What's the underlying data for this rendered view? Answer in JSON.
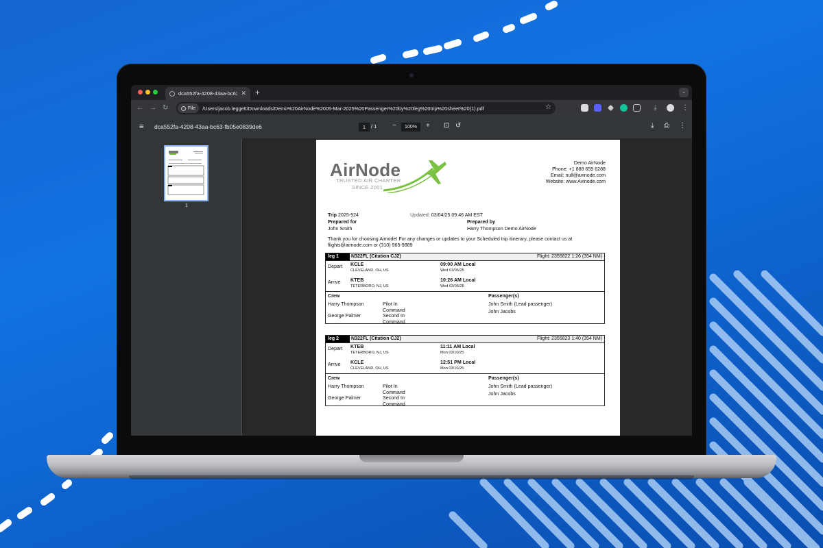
{
  "browser": {
    "tab_title": "dca552fa-4208-43aa-bc63-",
    "file_chip": "File",
    "url": "/Users/jacob.leggett/Downloads/Demo%20AirNode%2005-Mar-2025%20Passenger%20by%20leg%20trip%20sheet%20(1).pdf",
    "icons": [
      "back-icon",
      "forward-icon",
      "reload-icon",
      "star-icon",
      "download-icon",
      "menu-icon"
    ]
  },
  "pdf_viewer": {
    "title": "dca552fa-4208-43aa-bc63-fb05e0839de6",
    "page_current": "1",
    "page_total": "/ 1",
    "zoom": "100%",
    "thumbnail_label": "1"
  },
  "document": {
    "logo": {
      "name": "AirNode",
      "tagline_1": "TRUSTED AIR CHARTER",
      "tagline_2": "SINCE 2001",
      "color_green": "#7ac143",
      "color_gray": "#6a6a6a"
    },
    "company": {
      "name": "Demo AirNode",
      "phone_label": "Phone:",
      "phone": "+1 888 659 6288",
      "email_label": "Email:",
      "email": "null@avinode.com",
      "website_label": "Website:",
      "website": "www.Avinode.com"
    },
    "trip": {
      "label": "Trip",
      "number": "2025-924",
      "updated_label": "Updated:",
      "updated": "03/04/25 09:46 AM EST",
      "prepared_for_label": "Prepared for",
      "prepared_for": "John Smith",
      "prepared_by_label": "Prepared by",
      "prepared_by": "Harry Thompson Demo AirNode"
    },
    "greeting_line_1": "Thank you for choosing Aimode! For any changes or updates to your Scheduled trip itinerary, please contact us at",
    "greeting_line_2": "flights@airnode.com or (310) 965-9889",
    "legs": [
      {
        "label": "leg 1",
        "aircraft": "N322FL (Citation CJ2)",
        "flight": "Flight: 2355822 1:26 (354 NM)",
        "depart_label": "Depart",
        "depart_code": "KCLE",
        "depart_city": "CLEVELAND, OH, US",
        "depart_time": "09:00 AM Local",
        "depart_date": "Wed 03/05/25",
        "arrive_label": "Arrive",
        "arrive_code": "KTEB",
        "arrive_city": "TETERBORO, NJ, US",
        "arrive_time": "10:26 AM Local",
        "arrive_date": "Wed 03/05/25",
        "crew_label": "Crew",
        "crew": [
          {
            "name": "Harry Thompson",
            "role_1": "Pilot In",
            "role_2": "Command"
          },
          {
            "name": "George Palmer",
            "role_1": "Second In",
            "role_2": "Command"
          }
        ],
        "passengers_label": "Passenger(s)",
        "passengers": [
          "John Smith (Lead passenger)",
          "John Jacobs"
        ]
      },
      {
        "label": "leg 2",
        "aircraft": "N322FL (Citation CJ2)",
        "flight": "Flight: 2355823 1:40 (354 NM)",
        "depart_label": "Depart",
        "depart_code": "KTEB",
        "depart_city": "TETERBORO, NJ, US",
        "depart_time": "11:11 AM Local",
        "depart_date": "Mon 03/10/25",
        "arrive_label": "Arrive",
        "arrive_code": "KCLE",
        "arrive_city": "CLEVELAND, OH, US",
        "arrive_time": "12:51 PM Local",
        "arrive_date": "Mon 03/10/25",
        "crew_label": "Crew",
        "crew": [
          {
            "name": "Harry Thompson",
            "role_1": "Pilot In",
            "role_2": "Command"
          },
          {
            "name": "George Palmer",
            "role_1": "Second In",
            "role_2": "Command"
          }
        ],
        "passengers_label": "Passenger(s)",
        "passengers": [
          "John Smith (Lead passenger)",
          "John Jacobs"
        ]
      }
    ]
  }
}
